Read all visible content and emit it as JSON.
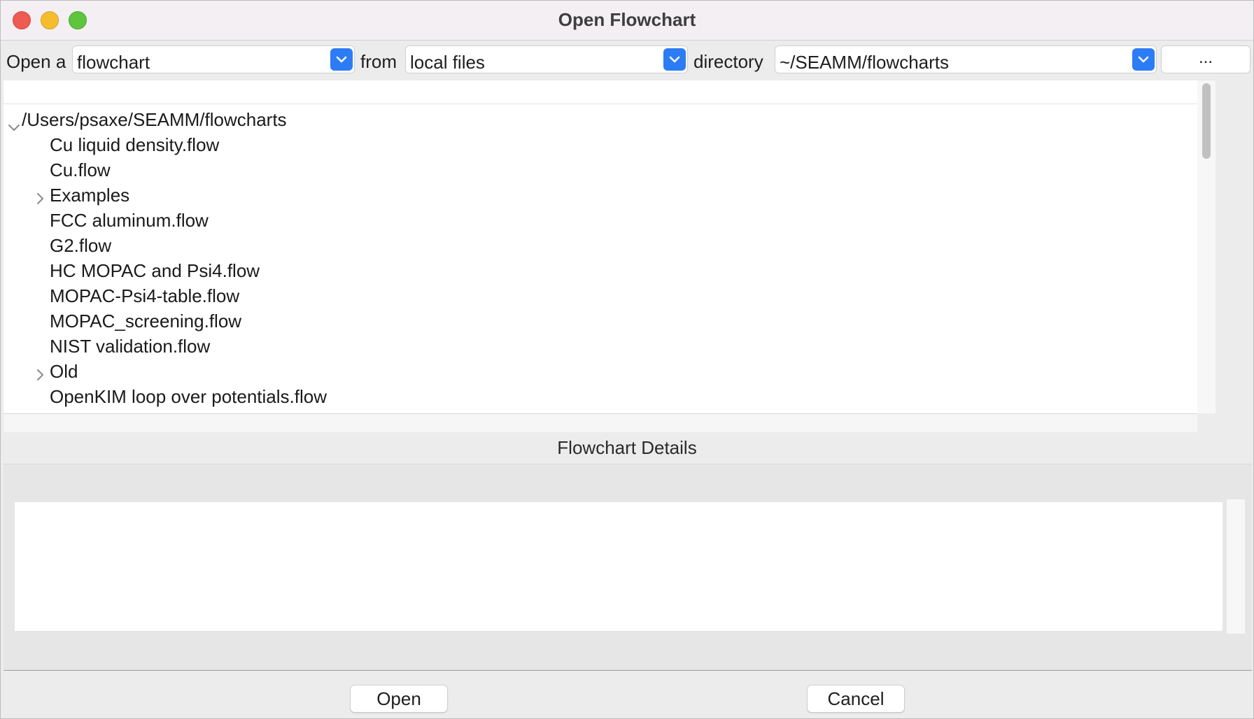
{
  "window": {
    "title": "Open Flowchart"
  },
  "toolbar": {
    "open_label": "Open a",
    "type_value": "flowchart",
    "from_label": "from",
    "source_value": "local files",
    "directory_label": "directory",
    "directory_value": "~/SEAMM/flowcharts",
    "browse_label": "..."
  },
  "tree": {
    "root": "/Users/psaxe/SEAMM/flowcharts",
    "items": [
      {
        "label": "Cu liquid density.flow",
        "folder": false
      },
      {
        "label": "Cu.flow",
        "folder": false
      },
      {
        "label": "Examples",
        "folder": true
      },
      {
        "label": "FCC aluminum.flow",
        "folder": false
      },
      {
        "label": "G2.flow",
        "folder": false
      },
      {
        "label": "HC MOPAC and Psi4.flow",
        "folder": false
      },
      {
        "label": "MOPAC-Psi4-table.flow",
        "folder": false
      },
      {
        "label": "MOPAC_screening.flow",
        "folder": false
      },
      {
        "label": "NIST validation.flow",
        "folder": false
      },
      {
        "label": "Old",
        "folder": true
      },
      {
        "label": "OpenKIM loop over potentials.flow",
        "folder": false
      }
    ]
  },
  "details": {
    "label": "Flowchart Details",
    "text": ""
  },
  "buttons": {
    "open": "Open",
    "cancel": "Cancel"
  },
  "icons": {
    "dropdown": "chevron-down-icon",
    "expanded": "chevron-down-icon",
    "collapsed": "chevron-right-icon"
  },
  "colors": {
    "accent": "#2c7cf5",
    "close": "#ee5b53",
    "minimize": "#f5bd2e",
    "maximize": "#5fc53e"
  }
}
